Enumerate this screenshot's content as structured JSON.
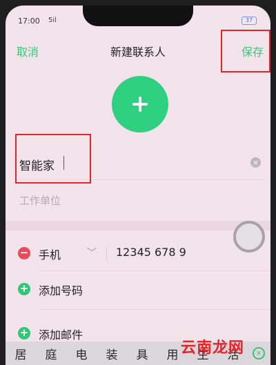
{
  "status_bar": {
    "time": "17:00",
    "signal": "5il",
    "battery": "37"
  },
  "nav": {
    "cancel": "取消",
    "title": "新建联系人",
    "save": "保存"
  },
  "avatar": {
    "icon": "plus-icon"
  },
  "name_field": {
    "value": "智能家"
  },
  "company_field": {
    "placeholder": "工作单位"
  },
  "phone_row": {
    "label": "手机",
    "number": "12345 678 9"
  },
  "add_number": {
    "label": "添加号码"
  },
  "add_email": {
    "label": "添加邮件"
  },
  "keyboard": {
    "candidates": [
      "居",
      "庭",
      "电",
      "装",
      "具",
      "用",
      "生",
      "活"
    ]
  },
  "watermark": "云南龙网",
  "colors": {
    "accent": "#3ec57b",
    "danger": "#e9485d",
    "highlight": "#e8222a"
  }
}
